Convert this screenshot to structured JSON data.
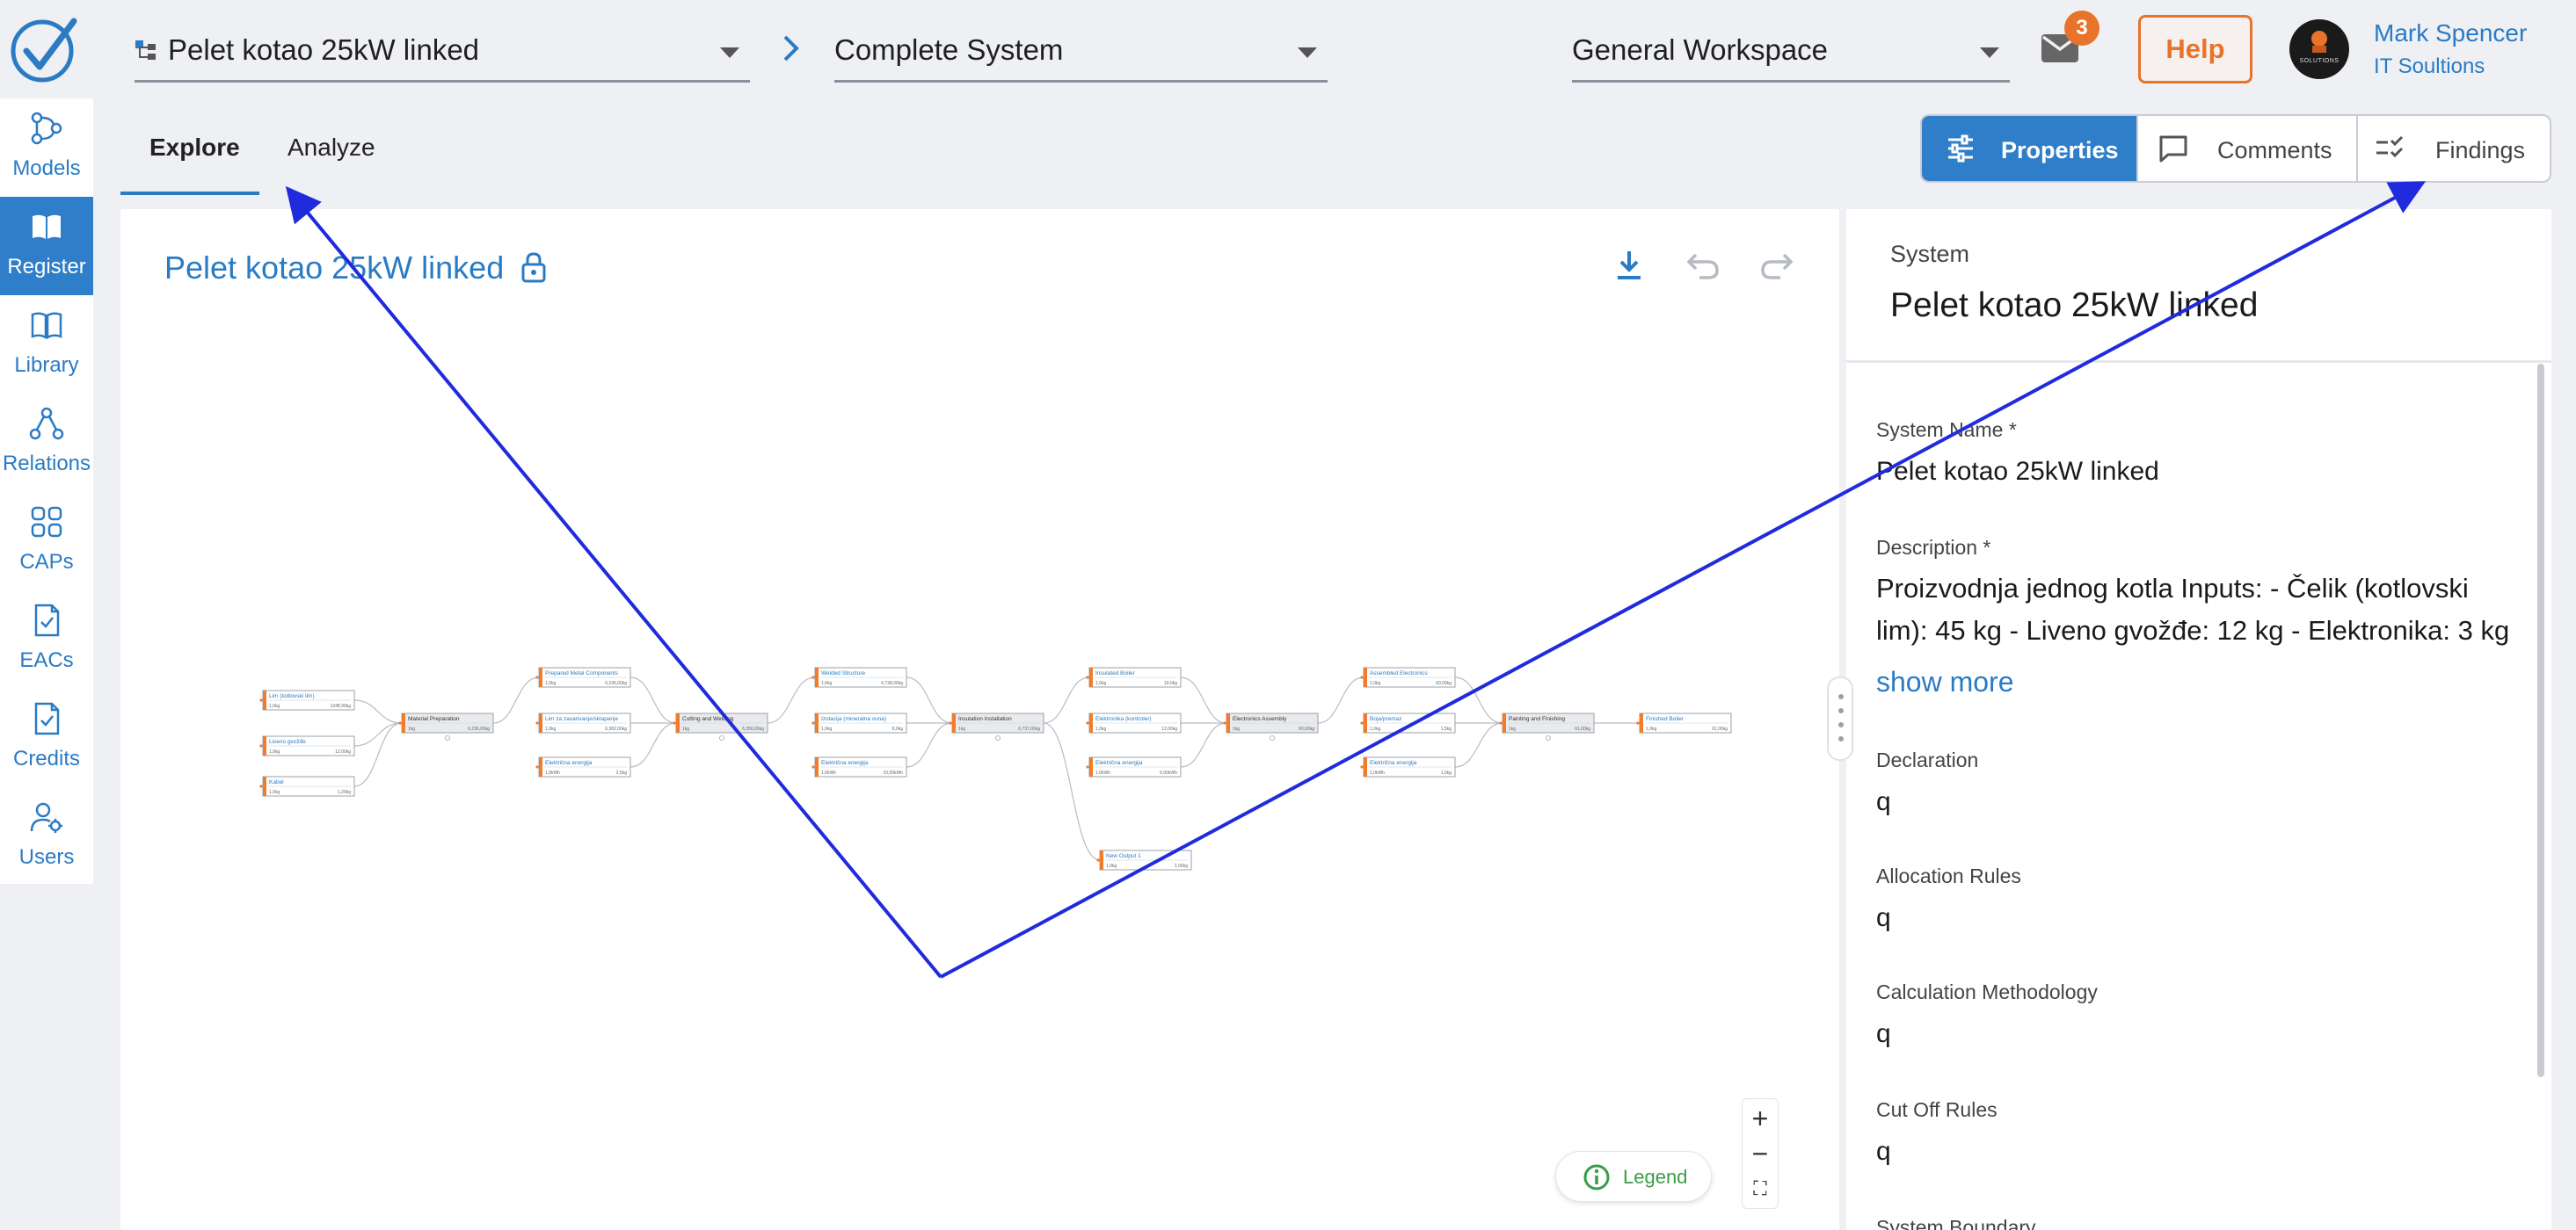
{
  "topbar": {
    "model_select": "Pelet kotao 25kW linked",
    "system_select": "Complete System",
    "workspace_select": "General Workspace",
    "mail_count": "3",
    "help_label": "Help",
    "user_name": "Mark Spencer",
    "user_org": "IT Soultions",
    "avatar_text": "SOLUTIONS"
  },
  "nav": {
    "items": [
      {
        "label": "Models",
        "icon": "models-icon"
      },
      {
        "label": "Register",
        "icon": "register-icon",
        "active": true
      },
      {
        "label": "Library",
        "icon": "library-icon"
      },
      {
        "label": "Relations",
        "icon": "relations-icon"
      },
      {
        "label": "CAPs",
        "icon": "caps-icon"
      },
      {
        "label": "EACs",
        "icon": "eacs-icon"
      },
      {
        "label": "Credits",
        "icon": "credits-icon"
      },
      {
        "label": "Users",
        "icon": "users-icon"
      }
    ]
  },
  "tabs": {
    "explore": "Explore",
    "analyze": "Analyze"
  },
  "view_buttons": {
    "properties": "Properties",
    "comments": "Comments",
    "findings": "Findings"
  },
  "canvas": {
    "title": "Pelet kotao 25kW linked",
    "legend_label": "Legend",
    "zoom_in": "+",
    "zoom_out": "−",
    "fit": "⛶"
  },
  "graph": {
    "nodes": [
      {
        "label": "Lim (kotlovski lim)",
        "a": "1,0kg",
        "b": "1348,90kg",
        "type": "input"
      },
      {
        "label": "Liveno gvožđe",
        "a": "1,0kg",
        "b": "12,00kg",
        "type": "input"
      },
      {
        "label": "Kabel",
        "a": "1,0kg",
        "b": "1,20kg",
        "type": "input"
      },
      {
        "label": "Material Preparation",
        "a": "1kg",
        "b": "6,236,00kg",
        "type": "process"
      },
      {
        "label": "Prepared Metal Components",
        "a": "1,0kg",
        "b": "6,236,00kg",
        "type": "input"
      },
      {
        "label": "Lim za zavarivanje/sklapanje",
        "a": "1,0kg",
        "b": "6,382,00kg",
        "type": "input"
      },
      {
        "label": "Električna energija",
        "a": "1,0kWh",
        "b": "2,5kg",
        "type": "input"
      },
      {
        "label": "Cutting and Welding",
        "a": "1kg",
        "b": "6,356,00kg",
        "type": "process"
      },
      {
        "label": "Welded Structure",
        "a": "1,0kg",
        "b": "6,738,00kg",
        "type": "input"
      },
      {
        "label": "Izolacija (mineralna vuna)",
        "a": "1,0kg",
        "b": "8,0kg",
        "type": "input"
      },
      {
        "label": "Električna energija",
        "a": "1,0kWh",
        "b": "10,00kWh",
        "type": "input"
      },
      {
        "label": "Insulation Installation",
        "a": "1kg",
        "b": "6,737,00kg",
        "type": "process"
      },
      {
        "label": "Insulated Boiler",
        "a": "1,0kg",
        "b": "10,0kg",
        "type": "input"
      },
      {
        "label": "Elektronika (kontroler)",
        "a": "1,0kg",
        "b": "12,00kg",
        "type": "input"
      },
      {
        "label": "Električna energija",
        "a": "1,0kWh",
        "b": "6,00kWh",
        "type": "input"
      },
      {
        "label": "Electronics Assembly",
        "a": "1kg",
        "b": "60,00kg",
        "type": "process"
      },
      {
        "label": "Assembled Electronics",
        "a": "1,0kg",
        "b": "60,00kg",
        "type": "input"
      },
      {
        "label": "Boja/premaz",
        "a": "1,0kg",
        "b": "1,5kg",
        "type": "input"
      },
      {
        "label": "Električna energija",
        "a": "1,0kWh",
        "b": "1,0kg",
        "type": "input"
      },
      {
        "label": "Painting and Finishing",
        "a": "1kg",
        "b": "61,00kg",
        "type": "process"
      },
      {
        "label": "Finished Boiler",
        "a": "1,0kg",
        "b": "61,00kg",
        "type": "output"
      },
      {
        "label": "New Output 1",
        "a": "1,0kg",
        "b": "1,00kg",
        "type": "output"
      }
    ]
  },
  "panel": {
    "kicker": "System",
    "title": "Pelet kotao 25kW linked",
    "fields": {
      "system_name_label": "System Name *",
      "system_name": "Pelet kotao 25kW linked",
      "description_label": "Description *",
      "description": "Proizvodnja jednog kotla Inputs: - Čelik (kotlovski lim): 45 kg - Liveno gvožđe: 12 kg - Elektronika: 3 kg",
      "show_more": "show more",
      "declaration_label": "Declaration",
      "declaration": "q",
      "allocation_label": "Allocation Rules",
      "allocation": "q",
      "calc_label": "Calculation Methodology",
      "calc": "q",
      "cutoff_label": "Cut Off Rules",
      "cutoff": "q",
      "boundary_label": "System Boundary"
    }
  },
  "colors": {
    "accent": "#2b7bc4",
    "active_nav": "#2e7ec9",
    "help": "#e8742c",
    "node_bar": "#f07c2c",
    "arrow": "#1f2bdc",
    "legend": "#3a9b47"
  }
}
